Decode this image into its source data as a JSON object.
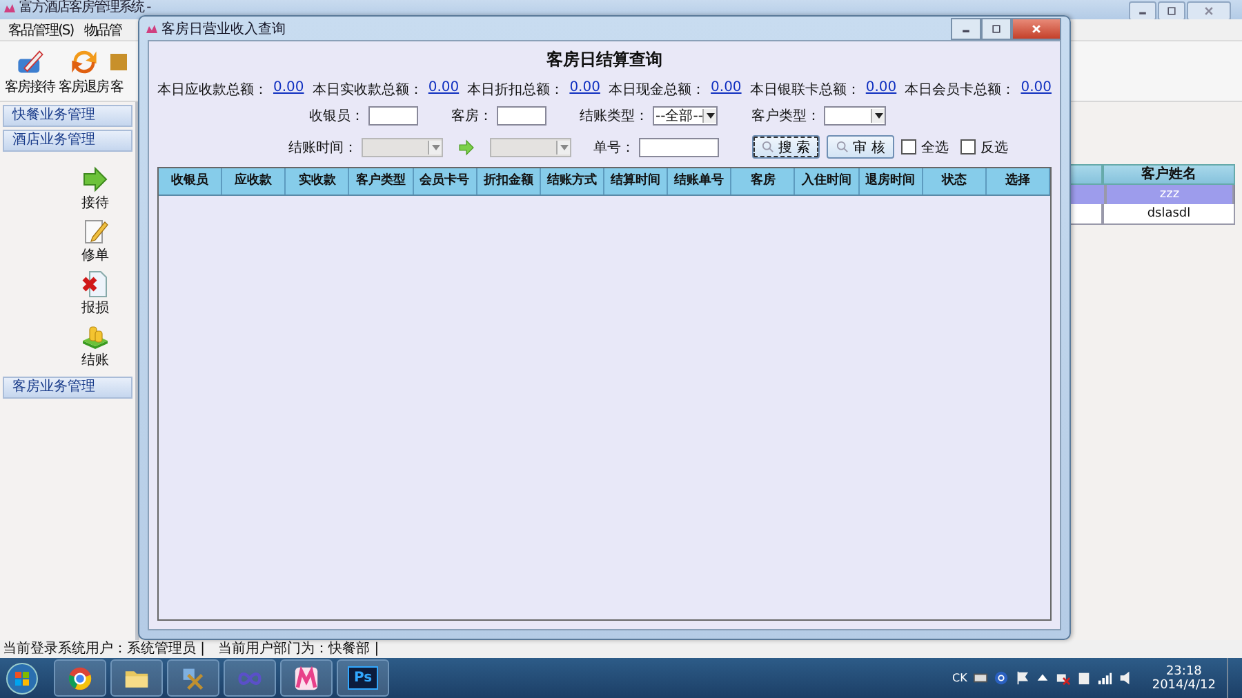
{
  "app": {
    "title": "富方酒店客房管理系统 -",
    "menu": [
      "客品管理(S)",
      "物品管"
    ],
    "toolbar": [
      {
        "label": "客房接待"
      },
      {
        "label": "客房退房"
      },
      {
        "label": "客"
      }
    ],
    "sidebar": [
      {
        "title": "快餐业务管理"
      },
      {
        "title": "酒店业务管理",
        "items": [
          {
            "label": "接待"
          },
          {
            "label": "修单"
          },
          {
            "label": "报损"
          },
          {
            "label": "结账"
          }
        ]
      },
      {
        "title": "客房业务管理"
      }
    ],
    "customer_table": {
      "columns": [
        "客户姓名"
      ],
      "rows": [
        {
          "cells": [
            "zzz"
          ],
          "selected": true
        },
        {
          "cells": [
            "dslasdl"
          ],
          "selected": false
        }
      ]
    },
    "status_bar": "当前登录系统用户：系统管理员 |   当前用户部门为：快餐部 |"
  },
  "dialog": {
    "title": "客房日营业收入查询",
    "heading": "客房日结算查询",
    "totals": [
      {
        "label": "本日应收款总额：",
        "value": "0.00"
      },
      {
        "label": "本日实收款总额：",
        "value": "0.00"
      },
      {
        "label": "本日折扣总额：",
        "value": "0.00"
      },
      {
        "label": "本日现金总额：",
        "value": "0.00"
      },
      {
        "label": "本日银联卡总额：",
        "value": "0.00"
      },
      {
        "label": "本日会员卡总额：",
        "value": "0.00"
      }
    ],
    "filters": [
      {
        "kind": "input",
        "label": "收银员："
      },
      {
        "kind": "input",
        "label": "客房："
      },
      {
        "kind": "select",
        "label": "结账类型：",
        "value": "--全部--",
        "disabled": false
      },
      {
        "kind": "select",
        "label": "客户类型：",
        "disabled": false
      }
    ],
    "time_filter": {
      "label": "结账时间：",
      "from_disabled": true,
      "to_disabled": true
    },
    "order_filter": {
      "label": "单号："
    },
    "buttons": [
      {
        "label": "搜 索",
        "focused": true
      },
      {
        "label": "审 核",
        "focused": false
      }
    ],
    "checkboxes": [
      {
        "label": "全选",
        "checked": false
      },
      {
        "label": "反选",
        "checked": false
      }
    ],
    "columns": [
      "收银员",
      "应收款",
      "实收款",
      "客户类型",
      "会员卡号",
      "折扣金额",
      "结账方式",
      "结算时间",
      "结账单号",
      "客房",
      "入住时间",
      "退房时间",
      "状态",
      "选择"
    ]
  },
  "taskbar": {
    "ps_label": "Ps",
    "tray_text": "CK",
    "time": "23:18",
    "date": "2014/4/12"
  }
}
